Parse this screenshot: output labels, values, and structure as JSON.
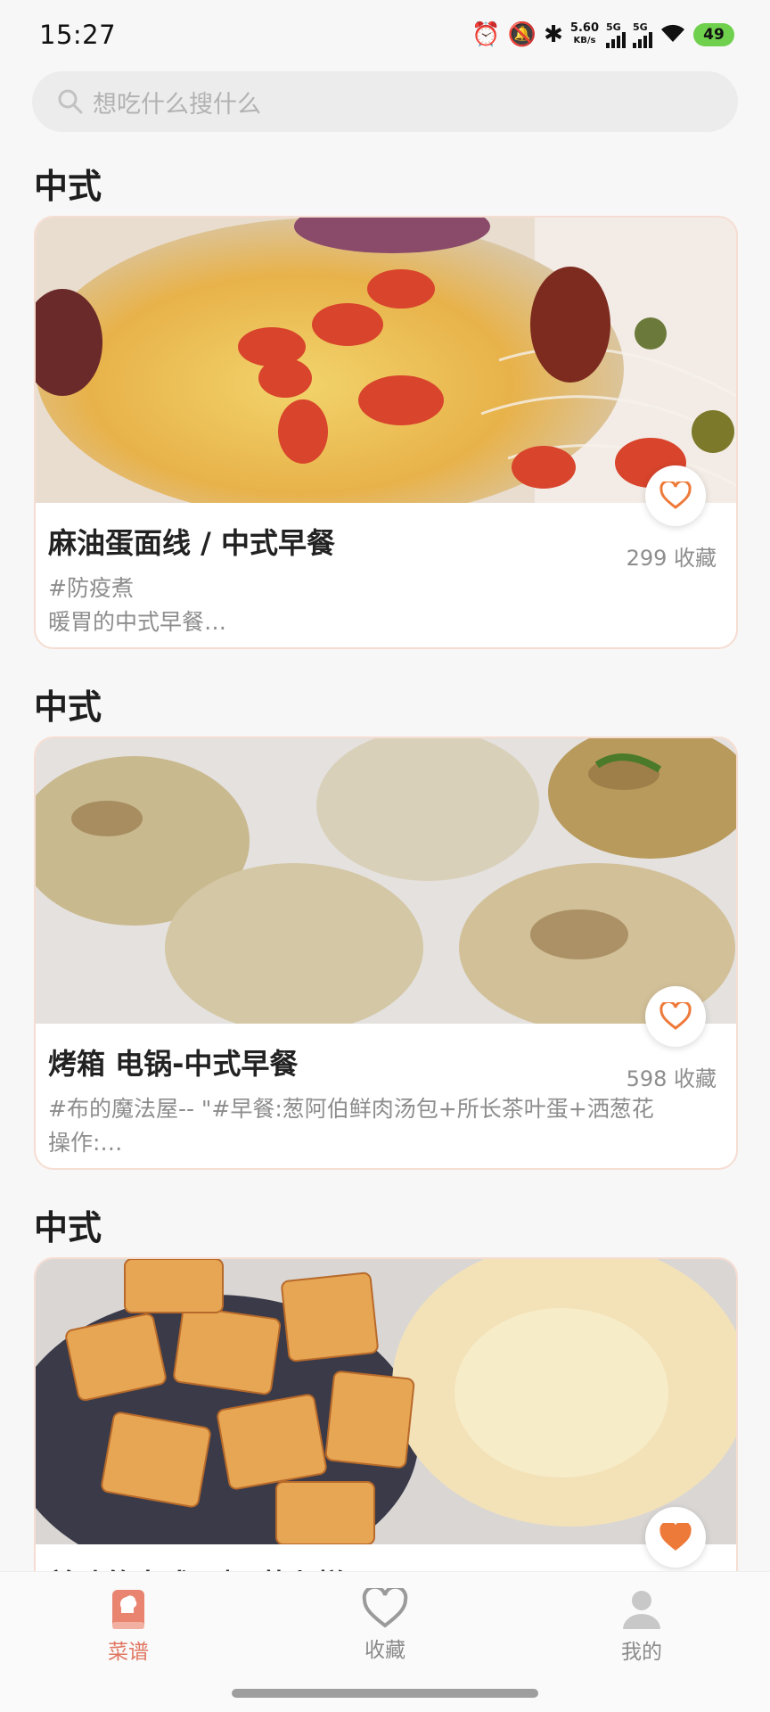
{
  "status_bar": {
    "time": "15:27",
    "net_speed_value": "5.60",
    "net_speed_unit": "KB/s",
    "sim1": "5G",
    "sim2": "5G",
    "battery": "49"
  },
  "search": {
    "placeholder": "想吃什么搜什么"
  },
  "sections": [
    {
      "title": "中式",
      "recipe": {
        "title": "麻油蛋面线 / 中式早餐",
        "favorites": "299 收藏",
        "tag": "#防疫煮",
        "desc": "暖胃的中式早餐…",
        "favorited": false
      }
    },
    {
      "title": "中式",
      "recipe": {
        "title": "烤箱 电锅-中式早餐",
        "favorites": "598 收藏",
        "tag": "#布的魔法屋-- \"#早餐:葱阿伯鲜肉汤包+所长茶叶蛋+洒葱花",
        "desc": "操作:…",
        "favorited": false
      }
    },
    {
      "title": "中式",
      "recipe": {
        "title": "美味的中式早餐-萝卜糕",
        "favorites": "",
        "tag": "",
        "desc": "",
        "favorited": true
      }
    }
  ],
  "tab_bar": {
    "tabs": [
      {
        "label": "菜谱",
        "icon": "recipe-book-icon",
        "active": true
      },
      {
        "label": "收藏",
        "icon": "heart-icon",
        "active": false
      },
      {
        "label": "我的",
        "icon": "person-icon",
        "active": false
      }
    ]
  },
  "colors": {
    "accent": "#e07762",
    "heart": "#ee7a3a",
    "card_border": "#f6ddd2",
    "background": "#f7f7f7"
  }
}
